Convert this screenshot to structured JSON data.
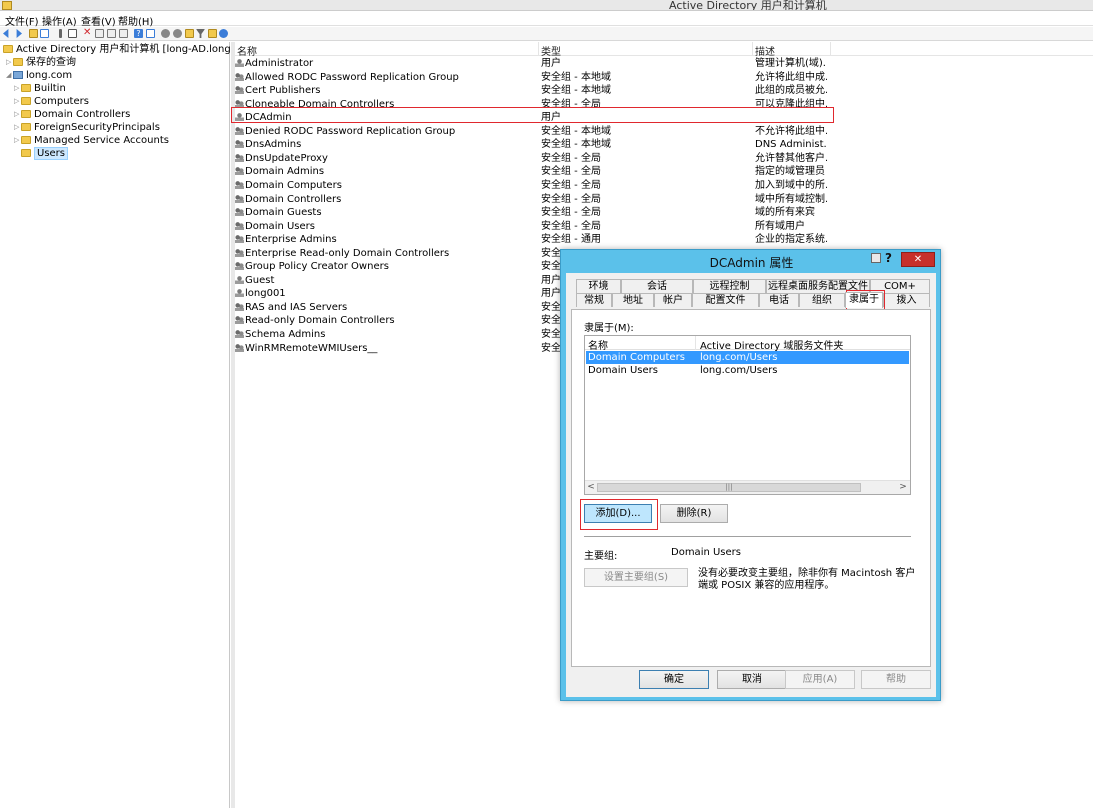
{
  "window": {
    "title": "Active Directory 用户和计算机"
  },
  "menu": [
    "文件(F)",
    "操作(A)",
    "查看(V)",
    "帮助(H)"
  ],
  "toolbar_icons": [
    "back-arrow-icon",
    "forward-arrow-icon",
    "folder-up-icon",
    "show-tree-icon",
    "cut-icon",
    "copy-icon",
    "delete-icon",
    "properties-icon",
    "refresh-icon",
    "export-icon",
    "help-icon",
    "view-icon",
    "add-user-icon",
    "add-group-icon",
    "add-ou-icon",
    "filter-icon",
    "find-icon",
    "add-to-group-icon"
  ],
  "tree": {
    "root": "Active Directory 用户和计算机 [long-AD.long.com]",
    "items": [
      {
        "label": "保存的查询",
        "level": 1,
        "expander": "▷"
      },
      {
        "label": "long.com",
        "level": 1,
        "expander": "◢"
      },
      {
        "label": "Builtin",
        "level": 2,
        "expander": "▷"
      },
      {
        "label": "Computers",
        "level": 2,
        "expander": "▷"
      },
      {
        "label": "Domain Controllers",
        "level": 2,
        "expander": "▷"
      },
      {
        "label": "ForeignSecurityPrincipals",
        "level": 2,
        "expander": "▷"
      },
      {
        "label": "Managed Service Accounts",
        "level": 2,
        "expander": "▷"
      },
      {
        "label": "Users",
        "level": 2,
        "expander": ""
      }
    ]
  },
  "list": {
    "headers": {
      "name": "名称",
      "type": "类型",
      "desc": "描述"
    },
    "rows": [
      {
        "icon": "user",
        "name": "Administrator",
        "type": "用户",
        "desc": "管理计算机(域)..."
      },
      {
        "icon": "group",
        "name": "Allowed RODC Password Replication Group",
        "type": "安全组 - 本地域",
        "desc": "允许将此组中成..."
      },
      {
        "icon": "group",
        "name": "Cert Publishers",
        "type": "安全组 - 本地域",
        "desc": "此组的成员被允..."
      },
      {
        "icon": "group",
        "name": "Cloneable Domain Controllers",
        "type": "安全组 - 全局",
        "desc": "可以克隆此组中..."
      },
      {
        "icon": "user",
        "name": "DCAdmin",
        "type": "用户",
        "desc": ""
      },
      {
        "icon": "group",
        "name": "Denied RODC Password Replication Group",
        "type": "安全组 - 本地域",
        "desc": "不允许将此组中..."
      },
      {
        "icon": "group",
        "name": "DnsAdmins",
        "type": "安全组 - 本地域",
        "desc": "DNS Administ..."
      },
      {
        "icon": "group",
        "name": "DnsUpdateProxy",
        "type": "安全组 - 全局",
        "desc": "允许替其他客户..."
      },
      {
        "icon": "group",
        "name": "Domain Admins",
        "type": "安全组 - 全局",
        "desc": "指定的域管理员"
      },
      {
        "icon": "group",
        "name": "Domain Computers",
        "type": "安全组 - 全局",
        "desc": "加入到域中的所..."
      },
      {
        "icon": "group",
        "name": "Domain Controllers",
        "type": "安全组 - 全局",
        "desc": "域中所有域控制..."
      },
      {
        "icon": "group",
        "name": "Domain Guests",
        "type": "安全组 - 全局",
        "desc": "域的所有来宾"
      },
      {
        "icon": "group",
        "name": "Domain Users",
        "type": "安全组 - 全局",
        "desc": "所有域用户"
      },
      {
        "icon": "group",
        "name": "Enterprise Admins",
        "type": "安全组 - 通用",
        "desc": "企业的指定系统..."
      },
      {
        "icon": "group",
        "name": "Enterprise Read-only Domain Controllers",
        "type": "安全",
        "desc": ""
      },
      {
        "icon": "group",
        "name": "Group Policy Creator Owners",
        "type": "安全",
        "desc": ""
      },
      {
        "icon": "user",
        "name": "Guest",
        "type": "用户",
        "desc": ""
      },
      {
        "icon": "user",
        "name": "long001",
        "type": "用户",
        "desc": ""
      },
      {
        "icon": "group",
        "name": "RAS and IAS Servers",
        "type": "安全",
        "desc": ""
      },
      {
        "icon": "group",
        "name": "Read-only Domain Controllers",
        "type": "安全",
        "desc": ""
      },
      {
        "icon": "group",
        "name": "Schema Admins",
        "type": "安全",
        "desc": ""
      },
      {
        "icon": "group",
        "name": "WinRMRemoteWMIUsers__",
        "type": "安全",
        "desc": ""
      }
    ]
  },
  "dialog": {
    "title": "DCAdmin 属性",
    "help_glyph": "?",
    "close_glyph": "✕",
    "tabs_row1": [
      "环境",
      "会话",
      "远程控制",
      "远程桌面服务配置文件",
      "COM+"
    ],
    "tabs_row2": [
      "常规",
      "地址",
      "帐户",
      "配置文件",
      "电话",
      "组织",
      "隶属于",
      "拨入"
    ],
    "active_tab": "隶属于",
    "member_of_label": "隶属于(M):",
    "grid_headers": {
      "name": "名称",
      "folder": "Active Directory 域服务文件夹"
    },
    "grid_rows": [
      {
        "name": "Domain Computers",
        "folder": "long.com/Users",
        "selected": true
      },
      {
        "name": "Domain Users",
        "folder": "long.com/Users",
        "selected": false
      }
    ],
    "scroll_left": "<",
    "scroll_thumb": "|||",
    "scroll_right": ">",
    "add_button": "添加(D)...",
    "remove_button": "删除(R)",
    "primary_group_label": "主要组:",
    "primary_group_value": "Domain Users",
    "set_primary_button": "设置主要组(S)",
    "primary_note": "没有必要改变主要组，除非你有 Macintosh 客户端或 POSIX 兼容的应用程序。",
    "ok_button": "确定",
    "cancel_button": "取消",
    "apply_button": "应用(A)",
    "help_button": "帮助"
  }
}
